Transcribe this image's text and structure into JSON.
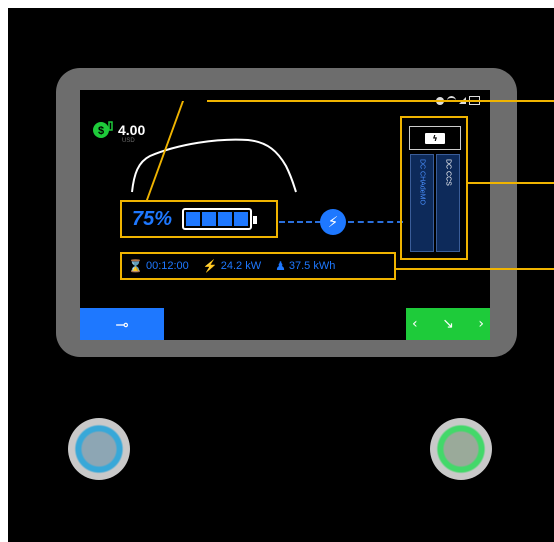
{
  "price": {
    "amount": "4.00",
    "currency": "USD"
  },
  "battery": {
    "percent_label": "75%",
    "level": 0.75
  },
  "connectors": [
    {
      "label": "DC CHAdeMO"
    },
    {
      "label": "DC CCS"
    }
  ],
  "stats": {
    "time": "00:12:00",
    "power": "24.2 kW",
    "energy": "37.5 kWh"
  },
  "colors": {
    "accent_blue": "#1e78ff",
    "callout": "#f0b400",
    "start_green": "#1ecb3a"
  },
  "icons": [
    "dollar-plug-icon",
    "car-outline-icon",
    "bolt-icon",
    "battery-connector-icon",
    "hourglass-icon",
    "flash-icon",
    "person-energy-icon",
    "back-plug-icon",
    "start-plug-icon",
    "status-icons"
  ]
}
